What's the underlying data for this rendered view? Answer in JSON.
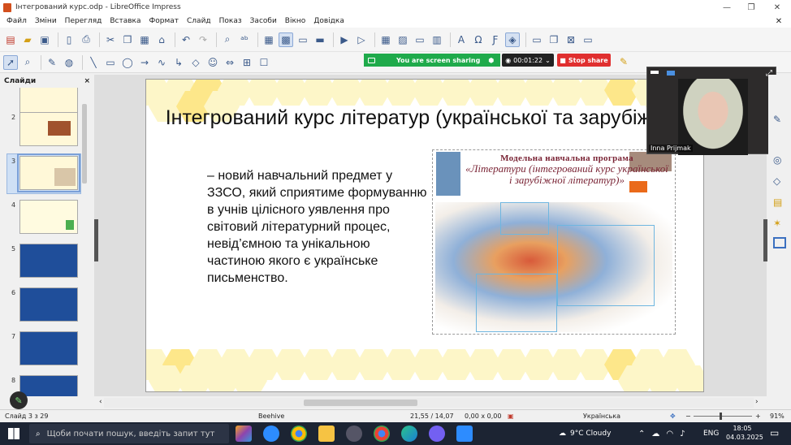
{
  "window": {
    "title": "Інтегрований курс.odp - LibreOffice Impress"
  },
  "menu": [
    "Файл",
    "Зміни",
    "Перегляд",
    "Вставка",
    "Формат",
    "Слайд",
    "Показ",
    "Засоби",
    "Вікно",
    "Довідка"
  ],
  "share": {
    "label": "You are screen sharing",
    "timer": "00:01:22",
    "stop": "Stop share"
  },
  "panel": {
    "title": "Слайди",
    "close": "×"
  },
  "thumbnails": [
    "2",
    "3",
    "4",
    "5",
    "6",
    "7",
    "8"
  ],
  "slide": {
    "title": "Інтегрований курс літератур (української та зарубіжної)",
    "body": "– новий навчальний предмет у ЗЗСО,  який сприятиме формуванню в учнів цілісного уявлення про світовий літературний процес, невід’ємною та унікальною частиною якого є українське письменство.",
    "image_caption_1": "Модельна навчальна програма",
    "image_caption_2": "«Літератури (інтегрований курс української і зарубіжної літератур)»"
  },
  "video": {
    "name": "Inna Prijmak"
  },
  "status": {
    "slide": "Слайд 3 з 29",
    "layout": "Beehive",
    "position": "21,55 / 14,07",
    "size": "0,00 x 0,00",
    "language": "Українська",
    "zoom": "91%"
  },
  "taskbar": {
    "search": "Щоби почати пошук, введіть запит тут",
    "weather": "9°C  Cloudy",
    "lang": "ENG",
    "time": "18:05",
    "date": "04.03.2025"
  }
}
